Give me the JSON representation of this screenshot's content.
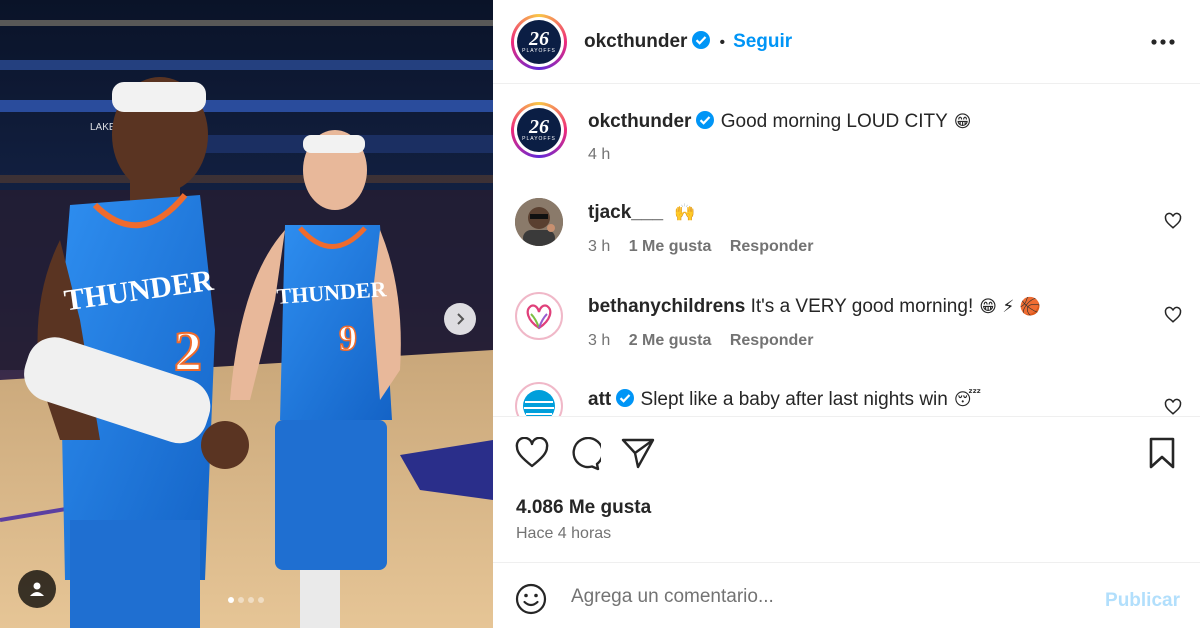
{
  "media": {
    "carousel_dots": 4,
    "active_dot": 0,
    "jersey_left_text": "THUNDER",
    "jersey_left_number": "2",
    "jersey_right_text": "THUNDER",
    "jersey_right_number": "9",
    "banner_text": "LAKERS PLAYOFFS"
  },
  "header": {
    "logo_big": "26",
    "logo_small": "PLAYOFFS",
    "username": "okcthunder",
    "bullet": "•",
    "follow_label": "Seguir"
  },
  "caption": {
    "username": "okcthunder",
    "text": "Good morning LOUD CITY",
    "emoji": "😁",
    "time": "4 h"
  },
  "comments": [
    {
      "username": "tjack___",
      "text": "",
      "emoji": "🙌",
      "time": "3 h",
      "likes": "1 Me gusta",
      "reply": "Responder"
    },
    {
      "username": "bethanychildrens",
      "text": "It's a VERY good morning!",
      "emoji": "😁 ⚡ 🏀",
      "time": "3 h",
      "likes": "2 Me gusta",
      "reply": "Responder"
    },
    {
      "username": "att",
      "text": "Slept like a baby after last nights win",
      "emoji": "😴",
      "time": "",
      "likes": "",
      "reply": ""
    }
  ],
  "stats": {
    "likes": "4.086 Me gusta",
    "time": "Hace 4 horas"
  },
  "composer": {
    "placeholder": "Agrega un comentario...",
    "publish_label": "Publicar"
  },
  "colors": {
    "accent": "#0095f6",
    "publish_disabled": "#b2dffc",
    "thunder_blue": "#1f7ce0",
    "thunder_orange": "#ef6b2d"
  }
}
